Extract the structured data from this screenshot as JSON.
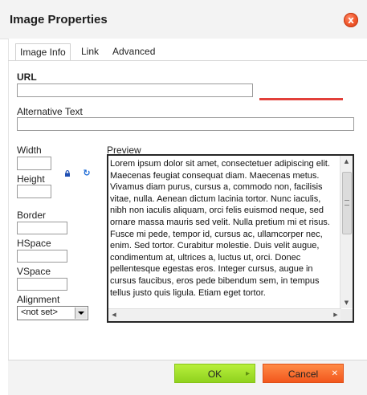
{
  "dialog": {
    "title": "Image Properties",
    "close_label": "x"
  },
  "tabs": [
    {
      "label": "Image Info",
      "active": true
    },
    {
      "label": "Link",
      "active": false
    },
    {
      "label": "Advanced",
      "active": false
    }
  ],
  "fields": {
    "url_label": "URL",
    "url_value": "",
    "alt_label": "Alternative Text",
    "alt_value": "",
    "width_label": "Width",
    "width_value": "",
    "height_label": "Height",
    "height_value": "",
    "border_label": "Border",
    "border_value": "",
    "hspace_label": "HSpace",
    "hspace_value": "",
    "vspace_label": "VSpace",
    "vspace_value": "",
    "alignment_label": "Alignment",
    "alignment_value": "<not set>"
  },
  "preview": {
    "label": "Preview",
    "text": "Lorem ipsum dolor sit amet, consectetuer adipiscing elit. Maecenas feugiat consequat diam. Maecenas metus. Vivamus diam purus, cursus a, commodo non, facilisis vitae, nulla. Aenean dictum lacinia tortor. Nunc iaculis, nibh non iaculis aliquam, orci felis euismod neque, sed ornare massa mauris sed velit. Nulla pretium mi et risus. Fusce mi pede, tempor id, cursus ac, ullamcorper nec, enim. Sed tortor. Curabitur molestie. Duis velit augue, condimentum at, ultrices a, luctus ut, orci. Donec pellentesque egestas eros. Integer cursus, augue in cursus faucibus, eros pede bibendum sem, in tempus tellus justo quis ligula. Etiam eget tortor."
  },
  "icons": {
    "lock": "lock-icon",
    "refresh": "refresh-icon",
    "close": "close-icon"
  },
  "buttons": {
    "ok_label": "OK",
    "cancel_label": "Cancel",
    "ok_icon": "▸",
    "cancel_icon": "✕"
  },
  "colors": {
    "ok_button": "#9cde2a",
    "cancel_button": "#f46a2e",
    "close_button": "#f25a2e",
    "accent_bar": "#e2403a"
  }
}
